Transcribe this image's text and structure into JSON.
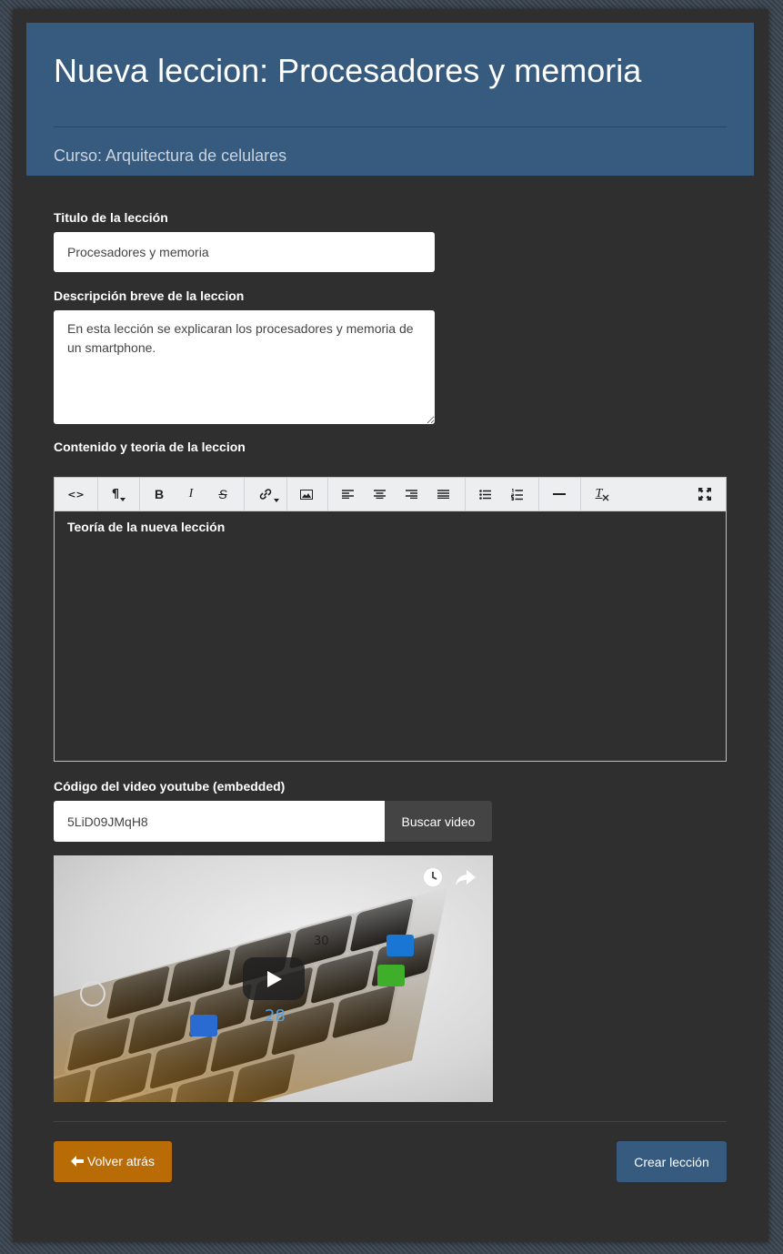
{
  "header": {
    "title": "Nueva leccion: Procesadores y memoria",
    "subtitle": "Curso: Arquitectura de celulares"
  },
  "form": {
    "title_label": "Titulo de la lección",
    "title_value": "Procesadores y memoria",
    "desc_label": "Descripción breve de la leccion",
    "desc_value": "En esta lección se explicaran los procesadores y memoria de un smartphone.",
    "content_label": "Contenido y teoria de la leccion",
    "content_value": "Teoría de la nueva lección",
    "video_label": "Código del video youtube (embedded)",
    "video_value": "5LiD09JMqH8",
    "search_button": "Buscar video"
  },
  "toolbar": {
    "code": "<>",
    "paragraph": "¶",
    "bold": "B",
    "italic": "I",
    "strike": "S",
    "clear": "T"
  },
  "video": {
    "thumb_numbers": [
      "30",
      "28"
    ]
  },
  "actions": {
    "back": "Volver atrás",
    "create": "Crear lección"
  },
  "colors": {
    "header_bg": "#375a7f",
    "back_btn": "#b96b06",
    "create_btn": "#375a7f"
  }
}
